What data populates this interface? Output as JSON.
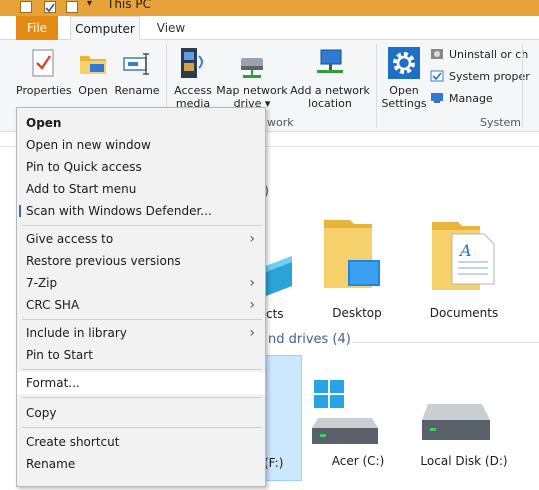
{
  "window": {
    "title": "This PC"
  },
  "tabs": [
    {
      "label": "File"
    },
    {
      "label": "Computer"
    },
    {
      "label": "View"
    }
  ],
  "ribbon": {
    "buttons": {
      "properties": "Properties",
      "open": "Open",
      "rename": "Rename",
      "access_media_1": "Access",
      "access_media_2": "media ▾",
      "map_drive_1": "Map network",
      "map_drive_2": "drive ▾",
      "add_location_1": "Add a network",
      "add_location_2": "location",
      "open_settings_1": "Open",
      "open_settings_2": "Settings"
    },
    "small_items": {
      "uninstall": "Uninstall or ch",
      "system_props": "System proper",
      "manage": "Manage"
    },
    "groups": {
      "network": "work",
      "system": "System"
    }
  },
  "content": {
    "folders_header": ")",
    "drives_header": "nd drives (4)",
    "folders": [
      {
        "label": "cts"
      },
      {
        "label": "Desktop"
      },
      {
        "label": "Documents"
      }
    ],
    "drives": [
      {
        "label": "(F:)"
      },
      {
        "label": "Acer (C:)"
      },
      {
        "label": "Local Disk (D:)"
      }
    ]
  },
  "context_menu": {
    "items": {
      "open": "Open",
      "open_new_window": "Open in new window",
      "pin_quick_access": "Pin to Quick access",
      "add_start_menu": "Add to Start menu",
      "scan_defender": "Scan with Windows Defender...",
      "give_access": "Give access to",
      "restore_versions": "Restore previous versions",
      "seven_zip": "7-Zip",
      "crc_sha": "CRC SHA",
      "include_library": "Include in library",
      "pin_start": "Pin to Start",
      "format": "Format...",
      "copy": "Copy",
      "create_shortcut": "Create shortcut",
      "rename": "Rename"
    },
    "submenu_arrow": "›"
  },
  "colors": {
    "title_bar": "#e8a23a",
    "file_tab": "#e38b14",
    "menu_bg": "#f2f2f2",
    "menu_highlight": "#ffffff",
    "selection": "#cce8ff"
  }
}
